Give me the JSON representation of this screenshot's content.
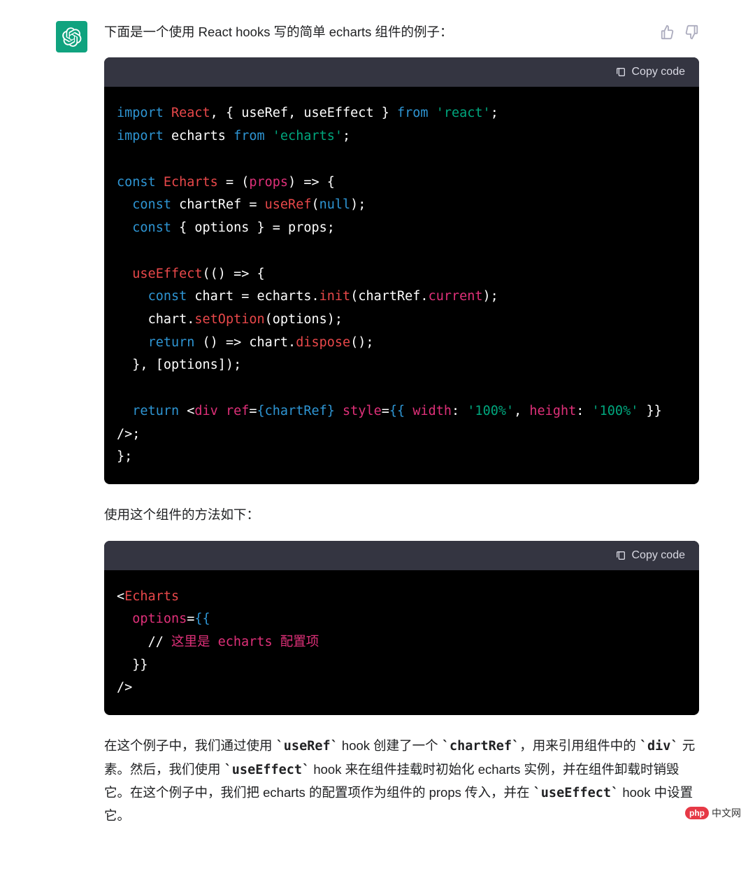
{
  "intro_text": "下面是一个使用 React hooks 写的简单 echarts 组件的例子：",
  "code1": {
    "copy_label": "Copy code",
    "tokens": {
      "import": "import",
      "React": "React",
      "useRef": "useRef",
      "useEffect": "useEffect",
      "from": "from",
      "react_str": "'react'",
      "echarts": "echarts",
      "echarts_str": "'echarts'",
      "const": "const",
      "Echarts": "Echarts",
      "chartRef": "chartRef",
      "useRef_call": "useRef",
      "null": "null",
      "options": "options",
      "props": "props",
      "useEffect_call": "useEffect",
      "chart": "chart",
      "init": "init",
      "current": "current",
      "setOption": "setOption",
      "return": "return",
      "dispose": "dispose",
      "div": "div",
      "ref": "ref",
      "style": "style",
      "width": "width",
      "hundred": "'100%'",
      "height": "height"
    },
    "plain": {
      "l1a": ", { ",
      "l1b": ", ",
      "l1c": " } ",
      "l1d": ";",
      "l2a": " ",
      "l2b": " ",
      "l2c": ";",
      "l4a": " ",
      "l4b": " = (",
      "l4c": ") => {",
      "l5a": "  ",
      "l5b": " chartRef = ",
      "l5c": "(",
      "l5d": ");",
      "l6a": "  ",
      "l6b": " { options } = props;",
      "l8a": "  ",
      "l8b": "(() => {",
      "l9a": "    ",
      "l9b": " chart = echarts.",
      "l9c": "(chartRef.",
      "l9d": ");",
      "l10a": "    chart.",
      "l10b": "(options);",
      "l11a": "    ",
      "l11b": " () => chart.",
      "l11c": "();",
      "l12a": "  }, [options]);",
      "l14a": "  ",
      "l14b": " <",
      "l14c": " ",
      "l14d": "=",
      "l14e": "{chartRef}",
      "l14f": " ",
      "l14g": "=",
      "l14h": "{{",
      "l14i": " ",
      "l14j": ": ",
      "l14k": ", ",
      "l14l": ": ",
      "l15a": " }} />;",
      "l16a": "};"
    }
  },
  "usage_text": "使用这个组件的方法如下：",
  "code2": {
    "copy_label": "Copy code",
    "tokens": {
      "Echarts": "Echarts",
      "options": "options",
      "comment": "这里是 echarts 配置项"
    },
    "plain": {
      "l1": "<",
      "l2a": "  ",
      "l2b": "=",
      "l2c": "{{",
      "l3a": "    // ",
      "l4": "  }}",
      "l5": "/>"
    }
  },
  "explanation": {
    "p1": "在这个例子中，我们通过使用 ",
    "c1": "`useRef`",
    "p2": " hook 创建了一个 ",
    "c2": "`chartRef`",
    "p3": "，用来引用组件中的 ",
    "c3": "`div`",
    "p4": " 元素。然后，我们使用 ",
    "c4": "`useEffect`",
    "p5": " hook 来在组件挂载时初始化 echarts 实例，并在组件卸载时销毁它。在这个例子中，我们把 echarts 的配置项作为组件的 props 传入，并在 ",
    "c5": "`useEffect`",
    "p6": " hook 中设置它。"
  },
  "watermark": {
    "badge": "php",
    "text": "中文网"
  }
}
